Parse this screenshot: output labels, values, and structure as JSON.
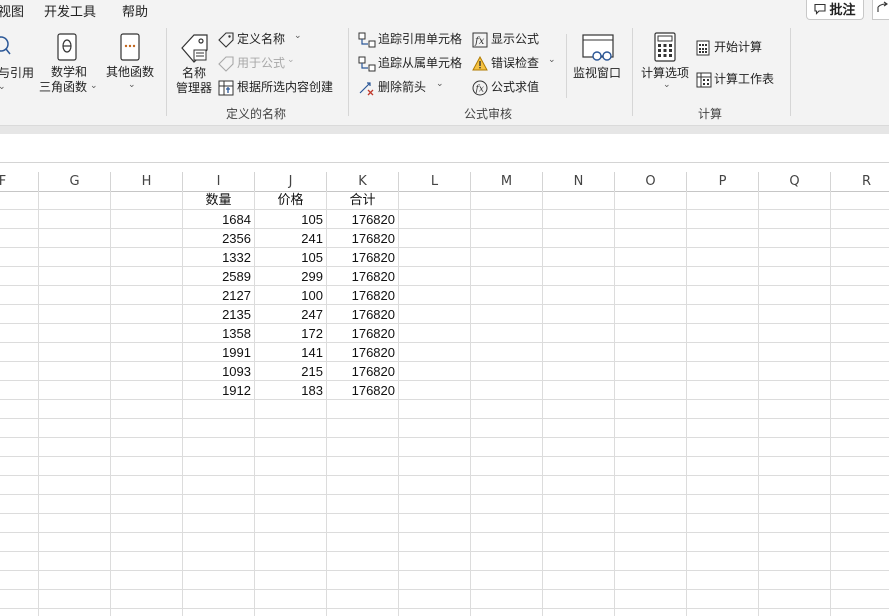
{
  "menu": {
    "items": [
      "视图",
      "开发工具",
      "帮助"
    ],
    "comment_label": "批注"
  },
  "ribbon": {
    "lookup_ref_label": "与引用",
    "math_label_1": "数学和",
    "math_label_2": "三角函数",
    "other_label": "其他函数",
    "name_mgr_1": "名称",
    "name_mgr_2": "管理器",
    "define_name": "定义名称",
    "use_in_formula": "用于公式",
    "create_from_sel": "根据所选内容创建",
    "defined_names_group": "定义的名称",
    "trace_precedents": "追踪引用单元格",
    "trace_dependents": "追踪从属单元格",
    "remove_arrows": "删除箭头",
    "show_formulas": "显示公式",
    "error_checking": "错误检查",
    "evaluate_formula": "公式求值",
    "watch_window": "监视窗口",
    "formula_auditing_group": "公式审核",
    "calc_options_1": "计算选项",
    "calc_now": "开始计算",
    "calc_sheet": "计算工作表",
    "calculation_group": "计算"
  },
  "columns": [
    "F",
    "G",
    "H",
    "I",
    "J",
    "K",
    "L",
    "M",
    "N",
    "O",
    "P",
    "Q",
    "R"
  ],
  "table": {
    "headers": [
      "数量",
      "价格",
      "合计"
    ],
    "rows": [
      [
        "1684",
        "105",
        "176820"
      ],
      [
        "2356",
        "241",
        "176820"
      ],
      [
        "1332",
        "105",
        "176820"
      ],
      [
        "2589",
        "299",
        "176820"
      ],
      [
        "2127",
        "100",
        "176820"
      ],
      [
        "2135",
        "247",
        "176820"
      ],
      [
        "1358",
        "172",
        "176820"
      ],
      [
        "1991",
        "141",
        "176820"
      ],
      [
        "1093",
        "215",
        "176820"
      ],
      [
        "1912",
        "183",
        "176820"
      ]
    ]
  },
  "colors": {
    "accent_blue": "#2b5797",
    "warning_yellow": "#e8a200"
  }
}
